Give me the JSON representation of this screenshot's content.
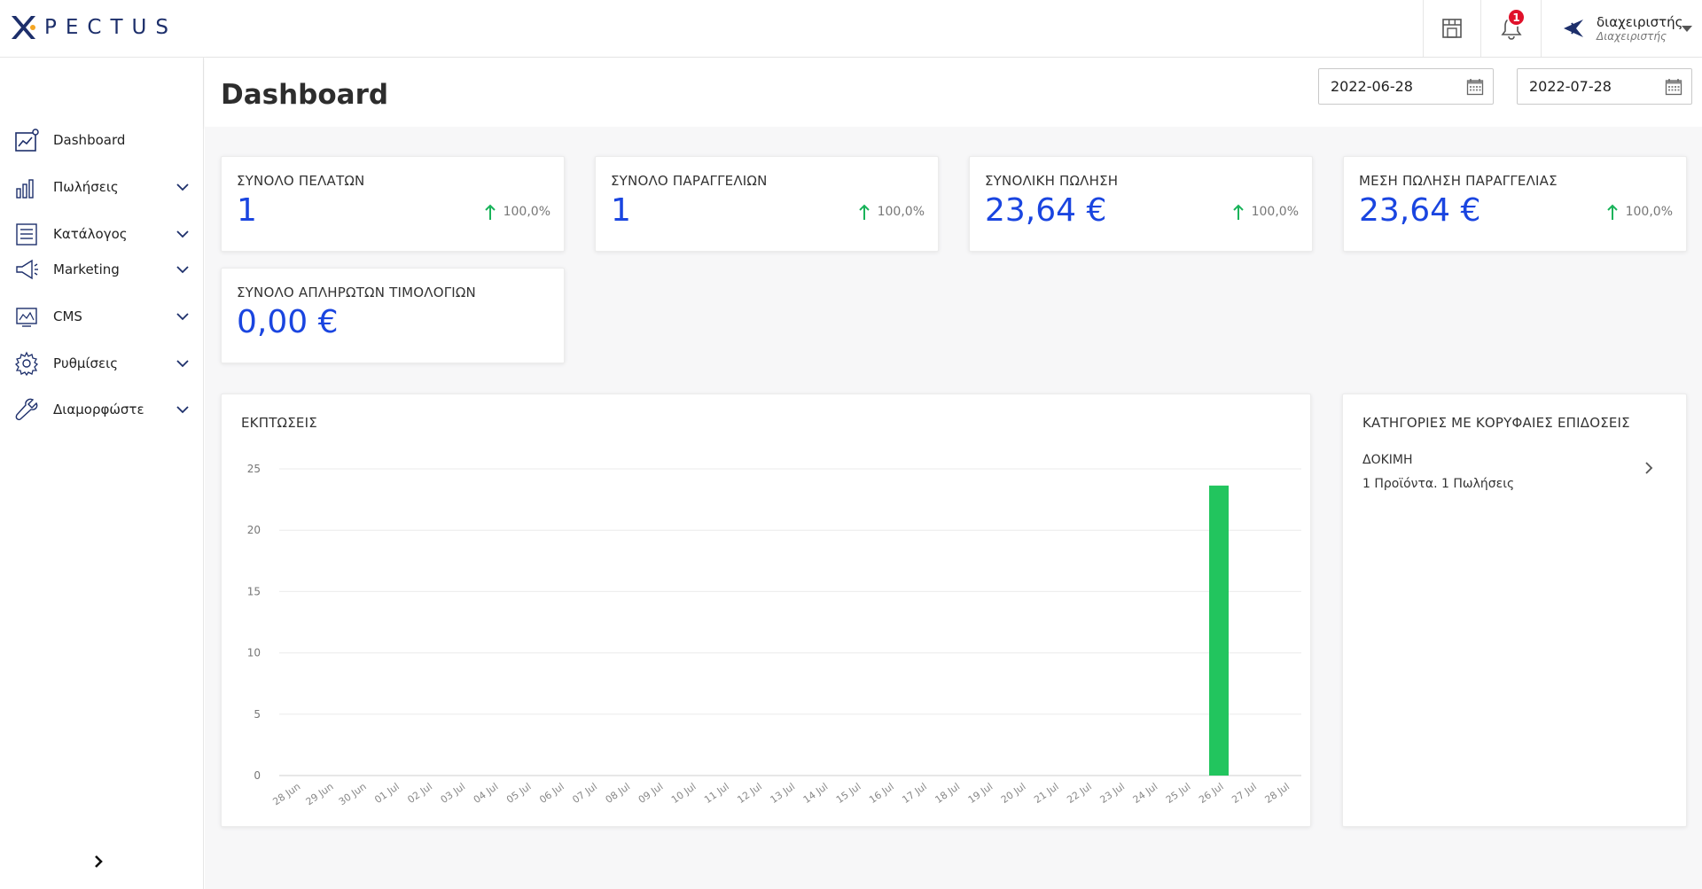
{
  "header": {
    "brand": "PECTUS",
    "notifications_count": "1",
    "user": {
      "name": "διαχειριστής",
      "role": "Διαχειριστής"
    }
  },
  "sidebar": {
    "items": [
      {
        "label": "Dashboard",
        "icon": "dashboard-chart-icon",
        "has_children": false
      },
      {
        "label": "Πωλήσεις",
        "icon": "bar-chart-icon",
        "has_children": true
      },
      {
        "label": "Κατάλογος",
        "icon": "catalog-list-icon",
        "has_children": true
      },
      {
        "label": "Marketing",
        "icon": "megaphone-icon",
        "has_children": true
      },
      {
        "label": "CMS",
        "icon": "cms-monitor-icon",
        "has_children": true
      },
      {
        "label": "Ρυθμίσεις",
        "icon": "gear-icon",
        "has_children": true
      },
      {
        "label": "Διαμορφώστε",
        "icon": "wrench-icon",
        "has_children": true
      }
    ]
  },
  "page": {
    "title": "Dashboard",
    "date_from": "2022-06-28",
    "date_to": "2022-07-28"
  },
  "stats": [
    {
      "title": "ΣΥΝΟΛΟ ΠΕΛΑΤΩΝ",
      "value": "1",
      "change": "100,0%"
    },
    {
      "title": "ΣΥΝΟΛΟ ΠΑΡΑΓΓΕΛΙΩΝ",
      "value": "1",
      "change": "100,0%"
    },
    {
      "title": "ΣΥΝΟΛΙΚΗ ΠΩΛΗΣΗ",
      "value": "23,64 €",
      "change": "100,0%"
    },
    {
      "title": "ΜΕΣΗ ΠΩΛΗΣΗ ΠΑΡΑΓΓΕΛΙΑΣ",
      "value": "23,64 €",
      "change": "100,0%"
    },
    {
      "title": "ΣΥΝΟΛΟ ΑΠΛΗΡΩΤΩΝ ΤΙΜΟΛΟΓΙΩΝ",
      "value": "0,00 €"
    }
  ],
  "top_categories": {
    "title": "ΚΑΤΗΓΟΡΙΕΣ ΜΕ ΚΟΡΥΦΑΙΕΣ ΕΠΙΔΟΣΕΙΣ",
    "items": [
      {
        "name": "ΔΟΚΙΜΗ",
        "summary": "1 Προϊόντα. 1 Πωλήσεις"
      }
    ]
  },
  "colors": {
    "accent_blue": "#1a45e0",
    "up_green": "#19b35a",
    "bar_green": "#22c55e",
    "badge_red": "#e0112a",
    "brand_navy": "#1d2f6b",
    "brand_orange": "#f5a623"
  },
  "chart_data": {
    "type": "bar",
    "title": "ΕΚΠΤΩΣΕΙΣ",
    "xlabel": "",
    "ylabel": "",
    "ylim": [
      0,
      25
    ],
    "yticks": [
      0,
      5,
      10,
      15,
      20,
      25
    ],
    "grid": true,
    "categories": [
      "28 Jun",
      "29 Jun",
      "30 Jun",
      "01 Jul",
      "02 Jul",
      "03 Jul",
      "04 Jul",
      "05 Jul",
      "06 Jul",
      "07 Jul",
      "08 Jul",
      "09 Jul",
      "10 Jul",
      "11 Jul",
      "12 Jul",
      "13 Jul",
      "14 Jul",
      "15 Jul",
      "16 Jul",
      "17 Jul",
      "18 Jul",
      "19 Jul",
      "20 Jul",
      "21 Jul",
      "22 Jul",
      "23 Jul",
      "24 Jul",
      "25 Jul",
      "26 Jul",
      "27 Jul",
      "28 Jul"
    ],
    "values": [
      0,
      0,
      0,
      0,
      0,
      0,
      0,
      0,
      0,
      0,
      0,
      0,
      0,
      0,
      0,
      0,
      0,
      0,
      0,
      0,
      0,
      0,
      0,
      0,
      0,
      0,
      0,
      0,
      23.64,
      0,
      0
    ]
  }
}
